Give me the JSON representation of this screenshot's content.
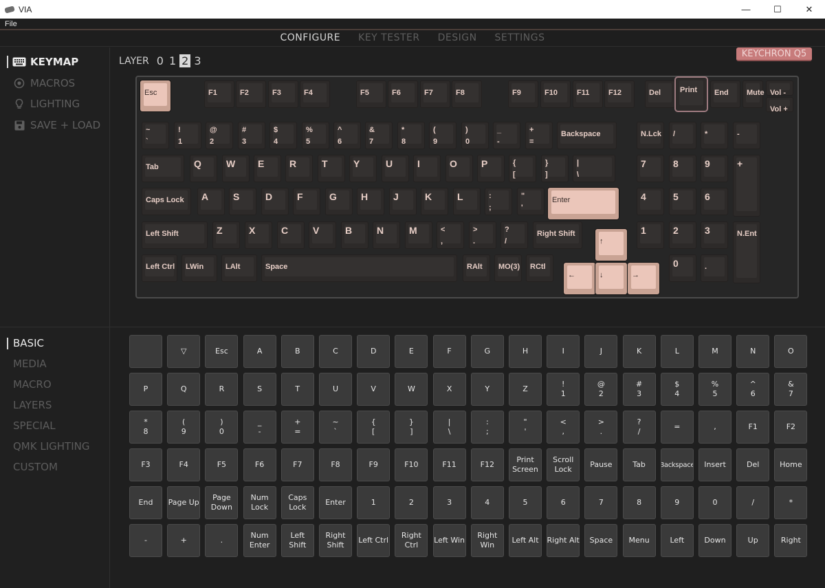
{
  "window": {
    "title": "VIA",
    "controls": [
      "—",
      "☐",
      "✕"
    ]
  },
  "menu": {
    "file": "File"
  },
  "topnav": [
    {
      "label": "CONFIGURE",
      "active": true
    },
    {
      "label": "KEY TESTER",
      "active": false
    },
    {
      "label": "DESIGN",
      "active": false
    },
    {
      "label": "SETTINGS",
      "active": false
    }
  ],
  "sidebar": [
    {
      "label": "KEYMAP",
      "icon": "keyboard-icon",
      "active": true
    },
    {
      "label": "MACROS",
      "icon": "record-icon",
      "active": false
    },
    {
      "label": "LIGHTING",
      "icon": "lightbulb-icon",
      "active": false
    },
    {
      "label": "SAVE + LOAD",
      "icon": "save-icon",
      "active": false
    }
  ],
  "layers": {
    "label": "LAYER",
    "options": [
      "0",
      "1",
      "2",
      "3"
    ],
    "selected": "2"
  },
  "keyboard_name": "KEYCHRON Q5",
  "keymap": [
    {
      "t": "Esc",
      "pink": true
    },
    {
      "t": "F1"
    },
    {
      "t": "F2"
    },
    {
      "t": "F3"
    },
    {
      "t": "F4"
    },
    {
      "t": "F5"
    },
    {
      "t": "F6"
    },
    {
      "t": "F7"
    },
    {
      "t": "F8"
    },
    {
      "t": "F9"
    },
    {
      "t": "F10"
    },
    {
      "t": "F11"
    },
    {
      "t": "F12"
    },
    {
      "t": "Del"
    },
    {
      "t": "Print",
      "selected": true
    },
    {
      "t": "End"
    },
    {
      "t": "Mute"
    },
    {
      "t": "Vol -"
    },
    {
      "t": "Vol +"
    },
    {
      "t": "~\n`"
    },
    {
      "t": "!\n1"
    },
    {
      "t": "@\n2"
    },
    {
      "t": "#\n3"
    },
    {
      "t": "$\n4"
    },
    {
      "t": "%\n5"
    },
    {
      "t": "^\n6"
    },
    {
      "t": "&\n7"
    },
    {
      "t": "*\n8"
    },
    {
      "t": "(\n9"
    },
    {
      "t": ")\n0"
    },
    {
      "t": "_\n-"
    },
    {
      "t": "+\n="
    },
    {
      "t": "Backspace"
    },
    {
      "t": "N.Lck"
    },
    {
      "t": "/"
    },
    {
      "t": "*"
    },
    {
      "t": "-"
    },
    {
      "t": "Tab"
    },
    {
      "t": "Q"
    },
    {
      "t": "W"
    },
    {
      "t": "E"
    },
    {
      "t": "R"
    },
    {
      "t": "T"
    },
    {
      "t": "Y"
    },
    {
      "t": "U"
    },
    {
      "t": "I"
    },
    {
      "t": "O"
    },
    {
      "t": "P"
    },
    {
      "t": "{\n["
    },
    {
      "t": "}\n]"
    },
    {
      "t": "|\n\\"
    },
    {
      "t": "7"
    },
    {
      "t": "8"
    },
    {
      "t": "9"
    },
    {
      "t": "+"
    },
    {
      "t": "Caps Lock"
    },
    {
      "t": "A"
    },
    {
      "t": "S"
    },
    {
      "t": "D"
    },
    {
      "t": "F"
    },
    {
      "t": "G"
    },
    {
      "t": "H"
    },
    {
      "t": "J"
    },
    {
      "t": "K"
    },
    {
      "t": "L"
    },
    {
      "t": ":\n;"
    },
    {
      "t": "\"\n'"
    },
    {
      "t": "Enter",
      "pink": true
    },
    {
      "t": "4"
    },
    {
      "t": "5"
    },
    {
      "t": "6"
    },
    {
      "t": "Left Shift"
    },
    {
      "t": "Z"
    },
    {
      "t": "X"
    },
    {
      "t": "C"
    },
    {
      "t": "V"
    },
    {
      "t": "B"
    },
    {
      "t": "N"
    },
    {
      "t": "M"
    },
    {
      "t": "<\n,"
    },
    {
      "t": ">\n."
    },
    {
      "t": "?\n/"
    },
    {
      "t": "Right Shift"
    },
    {
      "t": "↑",
      "pink": true
    },
    {
      "t": "1"
    },
    {
      "t": "2"
    },
    {
      "t": "3"
    },
    {
      "t": "N.Ent"
    },
    {
      "t": "Left Ctrl"
    },
    {
      "t": "LWin"
    },
    {
      "t": "LAlt"
    },
    {
      "t": "Space"
    },
    {
      "t": "RAlt"
    },
    {
      "t": "MO(3)"
    },
    {
      "t": "RCtl"
    },
    {
      "t": "←",
      "pink": true
    },
    {
      "t": "↓",
      "pink": true
    },
    {
      "t": "→",
      "pink": true
    },
    {
      "t": "0"
    },
    {
      "t": "."
    }
  ],
  "categories": [
    {
      "label": "BASIC",
      "active": true
    },
    {
      "label": "MEDIA",
      "active": false
    },
    {
      "label": "MACRO",
      "active": false
    },
    {
      "label": "LAYERS",
      "active": false
    },
    {
      "label": "SPECIAL",
      "active": false
    },
    {
      "label": "QMK LIGHTING",
      "active": false
    },
    {
      "label": "CUSTOM",
      "active": false
    }
  ],
  "basic_keys": [
    "",
    "▽",
    "Esc",
    "A",
    "B",
    "C",
    "D",
    "E",
    "F",
    "G",
    "H",
    "I",
    "J",
    "K",
    "L",
    "M",
    "N",
    "O",
    "P",
    "Q",
    "R",
    "S",
    "T",
    "U",
    "V",
    "W",
    "X",
    "Y",
    "Z",
    "!\n1",
    "@\n2",
    "#\n3",
    "$\n4",
    "%\n5",
    "^\n6",
    "&\n7",
    "*\n8",
    "(\n9",
    ")\n0",
    "_\n-",
    "+\n=",
    "~\n`",
    "{\n[",
    "}\n]",
    "|\n\\",
    ":\n;",
    "\"\n'",
    "<\n,",
    ">\n.",
    "?\n/",
    "=",
    ",",
    "F1",
    "F2",
    "F3",
    "F4",
    "F5",
    "F6",
    "F7",
    "F8",
    "F9",
    "F10",
    "F11",
    "F12",
    "Print\nScreen",
    "Scroll\nLock",
    "Pause",
    "Tab",
    "Backspace",
    "Insert",
    "Del",
    "Home",
    "End",
    "Page Up",
    "Page\nDown",
    "Num\nLock",
    "Caps\nLock",
    "Enter",
    "1",
    "2",
    "3",
    "4",
    "5",
    "6",
    "7",
    "8",
    "9",
    "0",
    "/",
    "*",
    "-",
    "+",
    ".",
    "Num\nEnter",
    "Left\nShift",
    "Right\nShift",
    "Left Ctrl",
    "Right\nCtrl",
    "Left Win",
    "Right\nWin",
    "Left Alt",
    "Right Alt",
    "Space",
    "Menu",
    "Left",
    "Down",
    "Up",
    "Right"
  ]
}
